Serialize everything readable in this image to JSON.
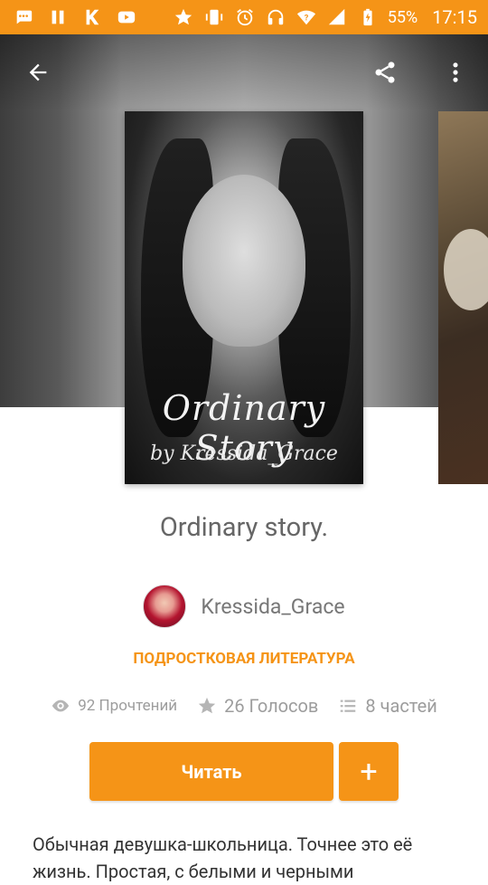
{
  "status_bar": {
    "battery_percent": "55%",
    "time": "17:15",
    "left_icons": [
      "chat-icon",
      "pause-icon",
      "k-icon",
      "youtube-icon"
    ],
    "right_icons": [
      "star-icon",
      "vibrate-icon",
      "alarm-icon",
      "headset-icon",
      "wifi-icon",
      "signal-icon",
      "battery-icon"
    ]
  },
  "story": {
    "cover_title": "Ordinary Story",
    "cover_author": "by Kressida_Grace",
    "title": "Ordinary story.",
    "author": "Kressida_Grace",
    "category": "ПОДРОСТКОВАЯ ЛИТЕРАТУРА",
    "description": "Обычная девушка-школьница. Точнее это её жизнь. Простая, с белыми и черными"
  },
  "stats": {
    "reads": "92 Прочтений",
    "votes": "26 Голосов",
    "parts": "8 частей"
  },
  "buttons": {
    "read": "Читать",
    "add": "+"
  },
  "colors": {
    "accent": "#f59417",
    "text": "#666666"
  }
}
